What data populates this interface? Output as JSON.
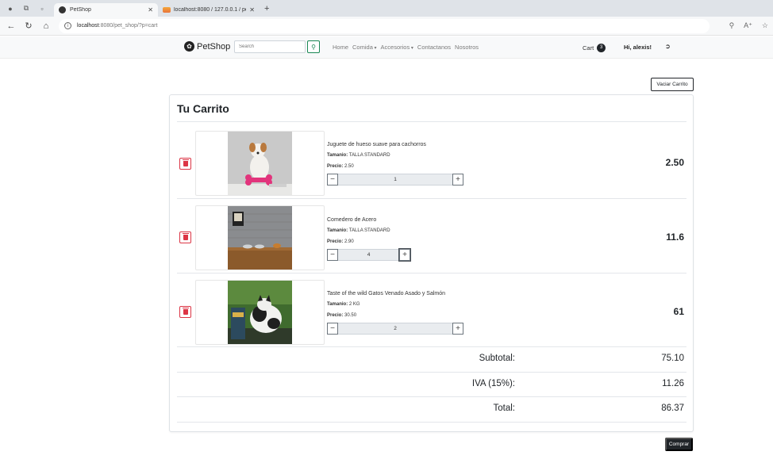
{
  "browser": {
    "tabs": [
      {
        "label": "PetShop",
        "active": true
      },
      {
        "label": "localhost:8080 / 127.0.0.1 / pet_sh",
        "active": false
      }
    ],
    "url_host": "localhost",
    "url_path": ":8080/pet_shop/?p=cart"
  },
  "nav": {
    "brand": "PetShop",
    "search_placeholder": "Search",
    "links": [
      "Home",
      "Comida",
      "Accesorios",
      "Contactanos",
      "Nosotros"
    ],
    "cart_label": "Cart",
    "cart_count": "3",
    "greeting": "Hi, alexis!"
  },
  "cart": {
    "clear_button": "Vaciar Carrito",
    "title": "Tu Carrito",
    "items": [
      {
        "name": "Juguete de hueso suave para cachorros",
        "size_label": "Tamanio:",
        "size": "TALLA STANDARD",
        "price_label": "Precio:",
        "price": "2.50",
        "quantity": "1",
        "total": "2.50"
      },
      {
        "name": "Comedero de Acero",
        "size_label": "Tamanio:",
        "size": "TALLA STANDARD",
        "price_label": "Precio:",
        "price": "2.90",
        "quantity": "4",
        "total": "11.6"
      },
      {
        "name": "Taste of the wild Gatos Venado Asado y Salmón",
        "size_label": "Tamanio:",
        "size": "2 KG",
        "price_label": "Precio:",
        "price": "30.50",
        "quantity": "2",
        "total": "61"
      }
    ],
    "subtotal_label": "Subtotal:",
    "subtotal": "75.10",
    "iva_label": "IVA (15%):",
    "iva": "11.26",
    "total_label": "Total:",
    "total": "86.37",
    "checkout_button": "Comprar"
  },
  "colors": {
    "delete": "#dc3545",
    "search_button": "#198754",
    "dark": "#212529"
  }
}
